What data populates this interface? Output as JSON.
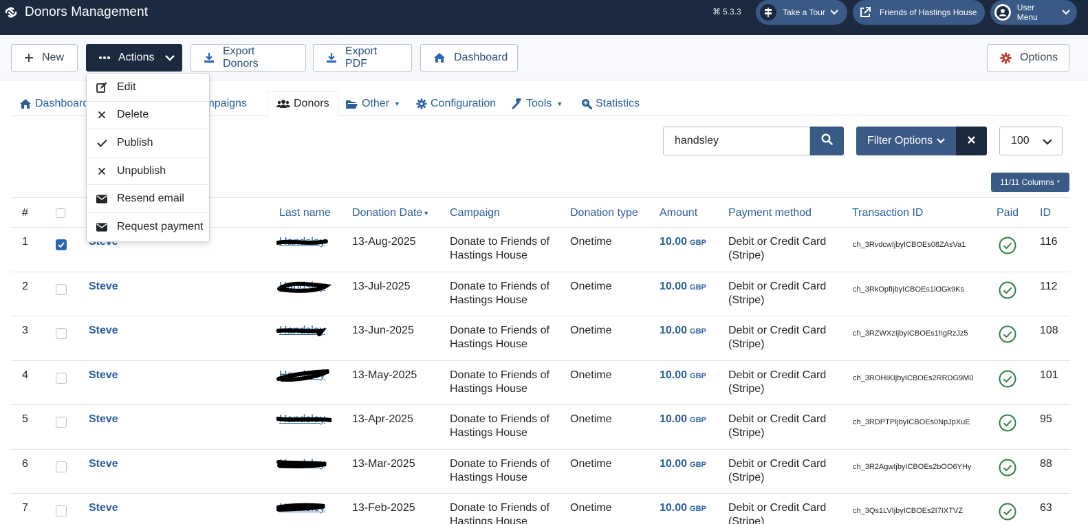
{
  "header": {
    "title": "Donors Management",
    "version": "5.3.3",
    "tour_label": "Take a Tour",
    "site_label": "Friends of Hastings House",
    "user_label": "User Menu"
  },
  "toolbar": {
    "new_label": "New",
    "actions_label": "Actions",
    "export_donors_label": "Export Donors",
    "export_pdf_label": "Export PDF",
    "dashboard_label": "Dashboard",
    "options_label": "Options"
  },
  "actions_menu": [
    {
      "label": "Edit",
      "icon": "edit-icon"
    },
    {
      "label": "Delete",
      "icon": "delete-icon"
    },
    {
      "label": "Publish",
      "icon": "check-icon"
    },
    {
      "label": "Unpublish",
      "icon": "unpublish-icon"
    },
    {
      "label": "Resend email",
      "icon": "envelope-icon"
    },
    {
      "label": "Request payment",
      "icon": "envelope-icon"
    }
  ],
  "subnav": {
    "dashboard": "Dashboard",
    "campaigns": "Campaigns",
    "donors": "Donors",
    "other": "Other",
    "configuration": "Configuration",
    "tools": "Tools",
    "statistics": "Statistics"
  },
  "filters": {
    "search_value": "handsley",
    "filter_options_label": "Filter Options",
    "limit_value": "100",
    "columns_label": "11/11 Columns"
  },
  "table": {
    "headers": {
      "num": "#",
      "last_name": "Last name",
      "donation_date": "Donation Date",
      "campaign": "Campaign",
      "donation_type": "Donation type",
      "amount": "Amount",
      "payment_method": "Payment method",
      "transaction_id": "Transaction ID",
      "paid": "Paid",
      "id": "ID"
    },
    "rows": [
      {
        "num": "1",
        "checked": true,
        "first_name": "Steve",
        "last_name": "Handsley",
        "date": "13-Aug-2025",
        "campaign_1": "Donate to Friends of",
        "campaign_2": "Hastings House",
        "type": "Onetime",
        "amount": "10.00",
        "currency": "GBP",
        "method_1": "Debit or Credit Card",
        "method_2": "(Stripe)",
        "txn": "ch_3RvdcwIjbyICBOEs08ZAsVa1",
        "id": "116"
      },
      {
        "num": "2",
        "checked": false,
        "first_name": "Steve",
        "last_name": "Handsley",
        "date": "13-Jul-2025",
        "campaign_1": "Donate to Friends of",
        "campaign_2": "Hastings House",
        "type": "Onetime",
        "amount": "10.00",
        "currency": "GBP",
        "method_1": "Debit or Credit Card",
        "method_2": "(Stripe)",
        "txn": "ch_3RkOpfIjbyICBOEs1lOGk9Ks",
        "id": "112"
      },
      {
        "num": "3",
        "checked": false,
        "first_name": "Steve",
        "last_name": "Handsley",
        "date": "13-Jun-2025",
        "campaign_1": "Donate to Friends of",
        "campaign_2": "Hastings House",
        "type": "Onetime",
        "amount": "10.00",
        "currency": "GBP",
        "method_1": "Debit or Credit Card",
        "method_2": "(Stripe)",
        "txn": "ch_3RZWXzIjbyICBOEs1hgRzJz5",
        "id": "108"
      },
      {
        "num": "4",
        "checked": false,
        "first_name": "Steve",
        "last_name": "Handsley",
        "date": "13-May-2025",
        "campaign_1": "Donate to Friends of",
        "campaign_2": "Hastings House",
        "type": "Onetime",
        "amount": "10.00",
        "currency": "GBP",
        "method_1": "Debit or Credit Card",
        "method_2": "(Stripe)",
        "txn": "ch_3ROHIKIjbyICBOEs2RRDG9M0",
        "id": "101"
      },
      {
        "num": "5",
        "checked": false,
        "first_name": "Steve",
        "last_name": "Handsley",
        "date": "13-Apr-2025",
        "campaign_1": "Donate to Friends of",
        "campaign_2": "Hastings House",
        "type": "Onetime",
        "amount": "10.00",
        "currency": "GBP",
        "method_1": "Debit or Credit Card",
        "method_2": "(Stripe)",
        "txn": "ch_3RDPTPIjbyICBOEs0NpJpXuE",
        "id": "95"
      },
      {
        "num": "6",
        "checked": false,
        "first_name": "Steve",
        "last_name": "Handsley",
        "date": "13-Mar-2025",
        "campaign_1": "Donate to Friends of",
        "campaign_2": "Hastings House",
        "type": "Onetime",
        "amount": "10.00",
        "currency": "GBP",
        "method_1": "Debit or Credit Card",
        "method_2": "(Stripe)",
        "txn": "ch_3R2AgwIjbyICBOEs2bOO6YHy",
        "id": "88"
      },
      {
        "num": "7",
        "checked": false,
        "first_name": "Steve",
        "last_name": "Handsley",
        "date": "13-Feb-2025",
        "campaign_1": "Donate to Friends of",
        "campaign_2": "Hastings House",
        "type": "Onetime",
        "amount": "10.00",
        "currency": "GBP",
        "method_1": "Debit or Credit Card",
        "method_2": "(Stripe)",
        "txn": "ch_3Qs1LVIjbyICBOEs2I7IXTVZ",
        "id": "63"
      }
    ]
  },
  "colors": {
    "header_bg": "#1c2a40",
    "accent": "#3a5a86",
    "link": "#2a5f9e",
    "paid_green": "#2e7d46",
    "options_red": "#c0392b"
  }
}
